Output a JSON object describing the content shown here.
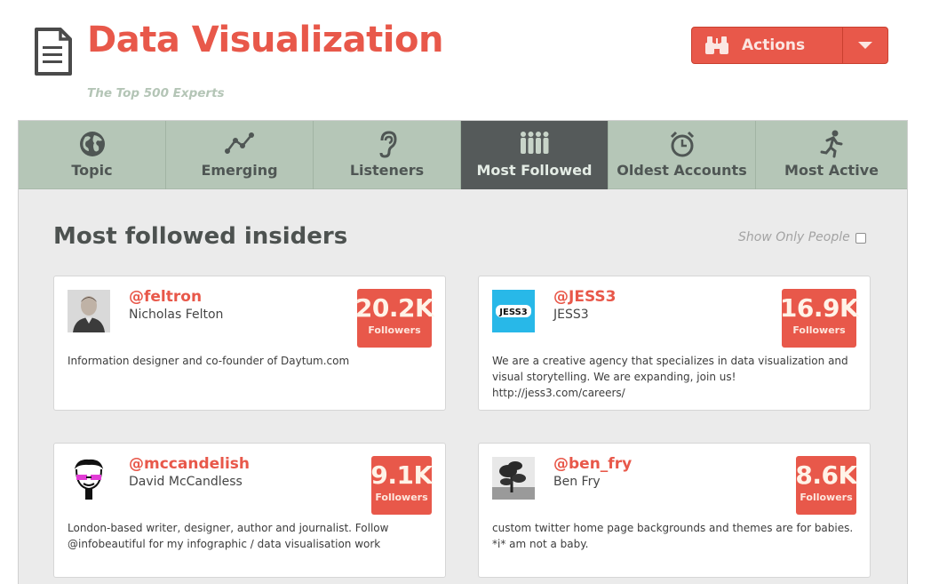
{
  "header": {
    "title": "Data Visualization",
    "subtitle": "The Top 500 Experts",
    "doc_icon": "document-icon"
  },
  "actions": {
    "label": "Actions",
    "icon": "binoculars-icon",
    "dropdown_icon": "caret-down-icon"
  },
  "tabs": [
    {
      "label": "Topic",
      "icon": "globe-icon"
    },
    {
      "label": "Emerging",
      "icon": "trend-line-icon"
    },
    {
      "label": "Listeners",
      "icon": "ear-icon"
    },
    {
      "label": "Most Followed",
      "icon": "crowd-icon",
      "active": true
    },
    {
      "label": "Oldest Accounts",
      "icon": "alarm-clock-icon"
    },
    {
      "label": "Most Active",
      "icon": "running-person-icon"
    }
  ],
  "section": {
    "heading": "Most followed insiders",
    "filter_label": "Show Only People",
    "filter_checked": false
  },
  "cards": [
    {
      "handle": "@feltron",
      "name": "Nicholas Felton",
      "followers": "20.2K",
      "followers_label": "Followers",
      "bio": "Information designer and co-founder of Daytum.com"
    },
    {
      "handle": "@JESS3",
      "name": "JESS3",
      "followers": "16.9K",
      "followers_label": "Followers",
      "bio": "We are a creative agency that specializes in data visualization and visual storytelling. We are expanding, join us! http://jess3.com/careers/",
      "avatar_text": "JESS3"
    },
    {
      "handle": "@mccandelish",
      "name": "David McCandless",
      "followers": "9.1K",
      "followers_label": "Followers",
      "bio": "London-based writer, designer, author and journalist. Follow @infobeautiful for my infographic / data visualisation work"
    },
    {
      "handle": "@ben_fry",
      "name": "Ben Fry",
      "followers": "8.6K",
      "followers_label": "Followers",
      "bio": "custom twitter home page backgrounds and themes are for babies. *i* am not a baby."
    }
  ],
  "colors": {
    "accent": "#e8584a",
    "tab_bar": "#b5c6b7",
    "tab_active": "#555a5a",
    "panel_bg": "#ebebeb"
  }
}
